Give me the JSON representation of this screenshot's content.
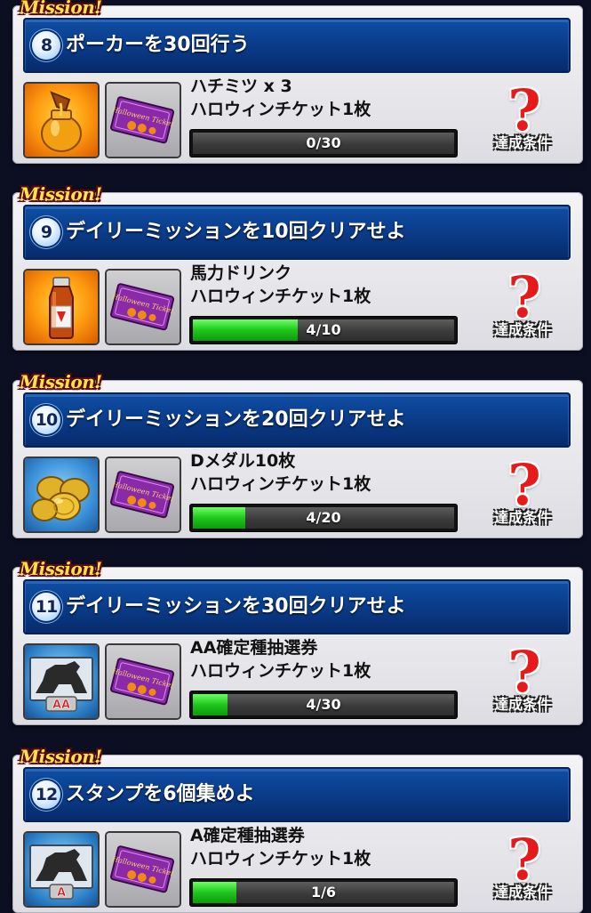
{
  "mission_tag": "Mission!",
  "condition_label": "達成条件",
  "ticket_reward": "ハロウィンチケット1枚",
  "missions": [
    {
      "number": "8",
      "title": "ポーカーを30回行う",
      "reward": "ハチミツ x 3",
      "reward_icon": "honey-icon",
      "progress_text": "0/30",
      "progress_fraction": 0.0
    },
    {
      "number": "9",
      "title": "デイリーミッションを10回クリアせよ",
      "reward": "馬力ドリンク",
      "reward_icon": "drink-icon",
      "progress_text": "4/10",
      "progress_fraction": 0.4
    },
    {
      "number": "10",
      "title": "デイリーミッションを20回クリアせよ",
      "reward": "Dメダル10枚",
      "reward_icon": "medal-icon",
      "progress_text": "4/20",
      "progress_fraction": 0.2
    },
    {
      "number": "11",
      "title": "デイリーミッションを30回クリアせよ",
      "reward": "AA確定種抽選券",
      "reward_icon": "horse-ticket-icon",
      "progress_text": "4/30",
      "progress_fraction": 0.133
    },
    {
      "number": "12",
      "title": "スタンプを6個集めよ",
      "reward": "A確定種抽選券",
      "reward_icon": "horse-ticket-icon",
      "progress_text": "1/6",
      "progress_fraction": 0.167
    }
  ],
  "colors": {
    "title_bar": "#0a3a86",
    "progress_fill": "#1fc61c",
    "question_mark": "#e8191a",
    "mission_tag": "#ffe34a"
  }
}
